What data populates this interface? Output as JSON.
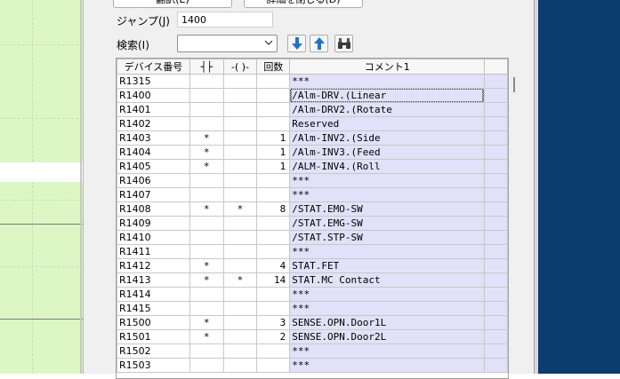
{
  "toolbar": {
    "button1_label": "翻訳(E)",
    "button2_label": "詳細を閉じる(D)"
  },
  "jump": {
    "label": "ジャンプ(J)",
    "value": "1400"
  },
  "search": {
    "label": "検索(I)",
    "value": ""
  },
  "table": {
    "headers": [
      "デバイス番号",
      "┤├",
      "-( )-",
      "回数",
      "コメント1"
    ],
    "rows": [
      {
        "device": "R1315",
        "contact": "",
        "coil": "",
        "count": "",
        "comment": "***"
      },
      {
        "device": "R1400",
        "contact": "",
        "coil": "",
        "count": "",
        "comment": "/Alm-DRV.(Linear"
      },
      {
        "device": "R1401",
        "contact": "",
        "coil": "",
        "count": "",
        "comment": "/Alm-DRV2.(Rotate"
      },
      {
        "device": "R1402",
        "contact": "",
        "coil": "",
        "count": "",
        "comment": "Reserved"
      },
      {
        "device": "R1403",
        "contact": "*",
        "coil": "",
        "count": "1",
        "comment": "/Alm-INV2.(Side"
      },
      {
        "device": "R1404",
        "contact": "*",
        "coil": "",
        "count": "1",
        "comment": "/Alm-INV3.(Feed"
      },
      {
        "device": "R1405",
        "contact": "*",
        "coil": "",
        "count": "1",
        "comment": "/ALM-INV4.(Roll"
      },
      {
        "device": "R1406",
        "contact": "",
        "coil": "",
        "count": "",
        "comment": "***"
      },
      {
        "device": "R1407",
        "contact": "",
        "coil": "",
        "count": "",
        "comment": "***"
      },
      {
        "device": "R1408",
        "contact": "*",
        "coil": "*",
        "count": "8",
        "comment": "/STAT.EMO-SW"
      },
      {
        "device": "R1409",
        "contact": "",
        "coil": "",
        "count": "",
        "comment": "/STAT.EMG-SW"
      },
      {
        "device": "R1410",
        "contact": "",
        "coil": "",
        "count": "",
        "comment": "/STAT.STP-SW"
      },
      {
        "device": "R1411",
        "contact": "",
        "coil": "",
        "count": "",
        "comment": "***"
      },
      {
        "device": "R1412",
        "contact": "*",
        "coil": "",
        "count": "4",
        "comment": "STAT.FET"
      },
      {
        "device": "R1413",
        "contact": "*",
        "coil": "*",
        "count": "14",
        "comment": "STAT.MC Contact"
      },
      {
        "device": "R1414",
        "contact": "",
        "coil": "",
        "count": "",
        "comment": "***"
      },
      {
        "device": "R1415",
        "contact": "",
        "coil": "",
        "count": "",
        "comment": "***"
      },
      {
        "device": "R1500",
        "contact": "*",
        "coil": "",
        "count": "3",
        "comment": "SENSE.OPN.Door1L"
      },
      {
        "device": "R1501",
        "contact": "*",
        "coil": "",
        "count": "2",
        "comment": "SENSE.OPN.Door2L"
      },
      {
        "device": "R1502",
        "contact": "",
        "coil": "",
        "count": "",
        "comment": "***"
      },
      {
        "device": "R1503",
        "contact": "",
        "coil": "",
        "count": "",
        "comment": "***"
      }
    ]
  },
  "colors": {
    "editor_bg": "#ddf7c4",
    "comment_bg": "#e1e1f9",
    "dialog_bg": "#f0f0f0",
    "desktop_bg": "#0b3d6e",
    "arrow_blue": "#1e73c8"
  },
  "icons": {
    "down": "arrow-down-icon",
    "up": "arrow-up-icon",
    "binoculars": "binoculars-icon",
    "dropdown": "chevron-down-icon"
  }
}
